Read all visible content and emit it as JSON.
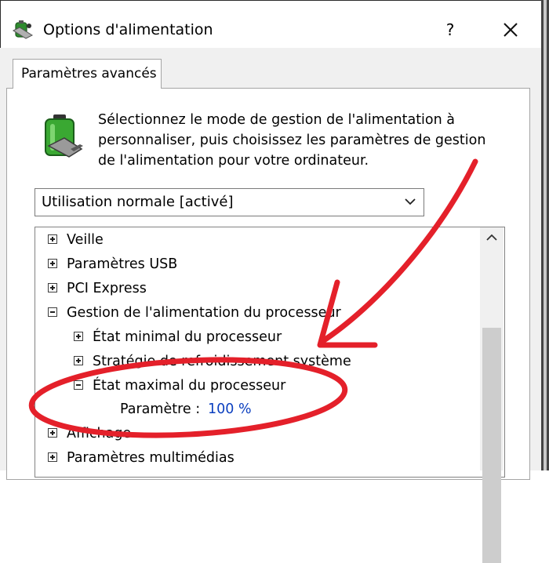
{
  "window": {
    "title": "Options d'alimentation",
    "help_glyph": "?",
    "close_icon": "close-icon"
  },
  "tab": {
    "label": "Paramètres avancés"
  },
  "description": {
    "line1": "Sélectionnez le mode de gestion de l'alimentation à",
    "line2": "personnaliser, puis choisissez les paramètres de gestion",
    "line3": "de l'alimentation pour votre ordinateur."
  },
  "plan_select": {
    "value": "Utilisation normale [activé]"
  },
  "tree": {
    "veille": "Veille",
    "usb": "Paramètres USB",
    "pci": "PCI Express",
    "processor": "Gestion de l'alimentation du processeur",
    "min_state": "État minimal du processeur",
    "cooling": "Stratégie de refroidissement système",
    "max_state": "État maximal du processeur",
    "setting_label": "Paramètre :",
    "setting_value": "100  %",
    "display": "Affichage",
    "multimedia": "Paramètres multimédias"
  },
  "colors": {
    "annotation_red": "#e4202a",
    "setting_blue": "#0b3fbf",
    "dialog_bg": "#f0f0f0"
  }
}
